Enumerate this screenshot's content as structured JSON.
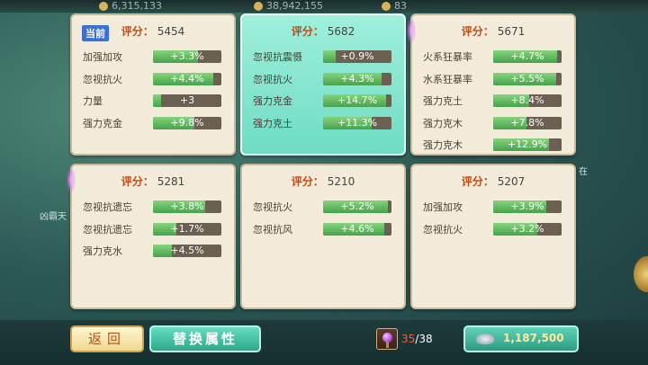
{
  "topbar": {
    "values": [
      "6,315,133",
      "38,942,155",
      "83"
    ]
  },
  "background": {
    "left_text": "凶霸天",
    "right_text": "在"
  },
  "badge_current": "当前",
  "cards": [
    {
      "score_label": "评分",
      "score_colon": "：",
      "score": "5454",
      "is_current": true,
      "selected": false,
      "attributes": [
        {
          "name": "加强加攻",
          "value": "+3.3%",
          "fill": 0.66
        },
        {
          "name": "忽视抗火",
          "value": "+4.4%",
          "fill": 0.88
        },
        {
          "name": "力量",
          "value": "+3",
          "fill": 0.12
        },
        {
          "name": "强力克金",
          "value": "+9.8%",
          "fill": 0.61
        }
      ]
    },
    {
      "score_label": "评分",
      "score_colon": "：",
      "score": "5682",
      "is_current": false,
      "selected": true,
      "attributes": [
        {
          "name": "忽视抗震慑",
          "value": "+0.9%",
          "fill": 0.18
        },
        {
          "name": "忽视抗火",
          "value": "+4.3%",
          "fill": 0.86
        },
        {
          "name": "强力克金",
          "value": "+14.7%",
          "fill": 0.92
        },
        {
          "name": "强力克土",
          "value": "+11.3%",
          "fill": 0.71
        }
      ]
    },
    {
      "score_label": "评分",
      "score_colon": "：",
      "score": "5671",
      "is_current": false,
      "selected": false,
      "attributes": [
        {
          "name": "火系狂暴率",
          "value": "+4.7%",
          "fill": 0.94
        },
        {
          "name": "水系狂暴率",
          "value": "+5.5%",
          "fill": 0.92
        },
        {
          "name": "强力克土",
          "value": "+8.4%",
          "fill": 0.53
        },
        {
          "name": "强力克木",
          "value": "+7.8%",
          "fill": 0.49
        },
        {
          "name": "强力克木",
          "value": "+12.9%",
          "fill": 0.81
        }
      ]
    },
    {
      "score_label": "评分",
      "score_colon": "：",
      "score": "5281",
      "is_current": false,
      "selected": false,
      "attributes": [
        {
          "name": "忽视抗遗忘",
          "value": "+3.8%",
          "fill": 0.76
        },
        {
          "name": "忽视抗遗忘",
          "value": "+1.7%",
          "fill": 0.34
        },
        {
          "name": "强力克水",
          "value": "+4.5%",
          "fill": 0.28
        }
      ]
    },
    {
      "score_label": "评分",
      "score_colon": "：",
      "score": "5210",
      "is_current": false,
      "selected": false,
      "attributes": [
        {
          "name": "忽视抗火",
          "value": "+5.2%",
          "fill": 0.95
        },
        {
          "name": "忽视抗风",
          "value": "+4.6%",
          "fill": 0.9
        }
      ]
    },
    {
      "score_label": "评分",
      "score_colon": "：",
      "score": "5207",
      "is_current": false,
      "selected": false,
      "attributes": [
        {
          "name": "加强加攻",
          "value": "+3.9%",
          "fill": 0.78
        },
        {
          "name": "忽视抗火",
          "value": "+3.2%",
          "fill": 0.64
        }
      ]
    }
  ],
  "buttons": {
    "return_label": "返回",
    "replace_label": "替换属性"
  },
  "item": {
    "current": "35",
    "separator": "/",
    "total": "38",
    "icon": "purple-gem-icon"
  },
  "currency": {
    "amount": "1,187,500",
    "icon": "silver-ingot-icon"
  },
  "colors": {
    "score_label": "#c24a16",
    "bar_fill": "#5ab85a",
    "selected_card": "#8ce8d2",
    "item_count_current": "#ff5a3a"
  }
}
